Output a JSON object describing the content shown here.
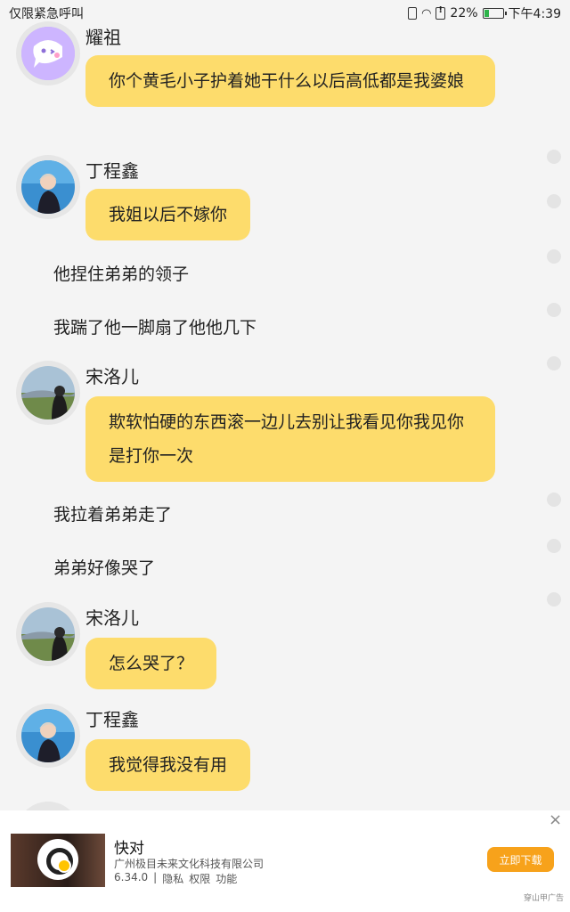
{
  "status_bar": {
    "left_text": "仅限紧急呼叫",
    "battery_percent": "22%",
    "time": "下午4:39"
  },
  "messages": [
    {
      "type": "speech",
      "speaker": "耀祖",
      "avatar": "purple-ghost-avatar",
      "text": "￼你个黄毛小子护着她干什么以后高低都是我婆娘"
    },
    {
      "type": "speech",
      "speaker": "丁程鑫",
      "avatar": "photo-avatar-boy",
      "text": "我姐以后不嫁你"
    },
    {
      "type": "narration",
      "text": "他捏住弟弟的领子"
    },
    {
      "type": "narration",
      "text": "我踹了他一脚扇了他他几下"
    },
    {
      "type": "speech",
      "speaker": "宋洛儿",
      "avatar": "photo-avatar-girl",
      "text": "欺软怕硬的东西滚一边儿去别让我看见你我见你是打你一次"
    },
    {
      "type": "narration",
      "text": "我拉着弟弟走了"
    },
    {
      "type": "narration",
      "text": "弟弟好像哭了"
    },
    {
      "type": "speech",
      "speaker": "宋洛儿",
      "avatar": "photo-avatar-girl",
      "text": "怎么哭了？"
    },
    {
      "type": "speech",
      "speaker": "丁程鑫",
      "avatar": "photo-avatar-boy",
      "text": "我觉得我没有用"
    }
  ],
  "ad": {
    "app_name": "快对",
    "company": "广州极目未来文化科技有限公司",
    "version": "6.34.0",
    "privacy": "隐私",
    "permissions": "权限",
    "features": "功能",
    "download_label": "立即下载",
    "ad_tag": "穿山甲广告",
    "close_glyph": "×"
  }
}
